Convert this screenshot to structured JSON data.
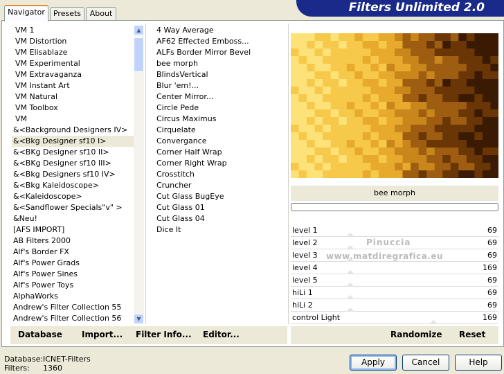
{
  "tabs": [
    {
      "label": "Navigator"
    },
    {
      "label": "Presets"
    },
    {
      "label": "About"
    }
  ],
  "banner_title": "Filters Unlimited 2.0",
  "categories": [
    "VM 1",
    "VM Distortion",
    "VM Elisablaze",
    "VM Experimental",
    "VM Extravaganza",
    "VM Instant Art",
    "VM Natural",
    "VM Toolbox",
    "VM",
    "&<Background Designers IV>",
    "&<Bkg Designer sf10 I>",
    "&<BKg Designer sf10 II>",
    "&<BKg Designer sf10 III>",
    "&<Bkg Designers sf10 IV>",
    "&<Bkg Kaleidoscope>",
    "&<Kaleidoscope>",
    "&<Sandflower Specials\"v\" >",
    "&Neu!",
    "[AFS IMPORT]",
    "AB Filters 2000",
    "Alf's Border FX",
    "Alf's Power Grads",
    "Alf's Power Sines",
    "Alf's Power Toys",
    "AlphaWorks",
    "Andrew's Filter Collection 55",
    "Andrew's Filter Collection 56"
  ],
  "filters": [
    "4 Way Average",
    "AF62 Effected Emboss...",
    "ALFs Border Mirror Bevel",
    "bee morph",
    "BlindsVertical",
    "Blur 'em!...",
    "Center Mirror...",
    "Circle Pede",
    "Circus Maximus",
    "Cirquelate",
    "Convergance",
    "Corner Half Wrap",
    "Corner Right Wrap",
    "Crosstitch",
    "Cruncher",
    "Cut Glass  BugEye",
    "Cut Glass 01",
    "Cut Glass 04",
    "Dice It"
  ],
  "left_buttons": {
    "database": "Database",
    "import": "Import...",
    "filter_info": "Filter Info...",
    "editor": "Editor..."
  },
  "preview": {
    "filter_name": "bee morph",
    "watermark_line1": "Pinuccia",
    "watermark_line2": "www.matdiregrafica.eu"
  },
  "params": [
    {
      "label": "level 1",
      "value": "69"
    },
    {
      "label": "level 2",
      "value": "69"
    },
    {
      "label": "level 3",
      "value": "69"
    },
    {
      "label": "level 4",
      "value": "169"
    },
    {
      "label": "level 5",
      "value": "69"
    },
    {
      "label": "hiLi 1",
      "value": "69"
    },
    {
      "label": "hiLi 2",
      "value": "69"
    },
    {
      "label": "control Light",
      "value": "169"
    }
  ],
  "right_buttons": {
    "randomize": "Randomize",
    "reset": "Reset"
  },
  "status": {
    "database_label": "Database:",
    "database_value": "ICNET-Filters",
    "filters_label": "Filters:",
    "filters_value": "1360"
  },
  "dialog_buttons": {
    "apply": "Apply",
    "cancel": "Cancel",
    "help": "Help"
  },
  "colors": {
    "accent": "#e68b2c",
    "banner": "#1a2a8a",
    "selection": "#316ac5"
  }
}
